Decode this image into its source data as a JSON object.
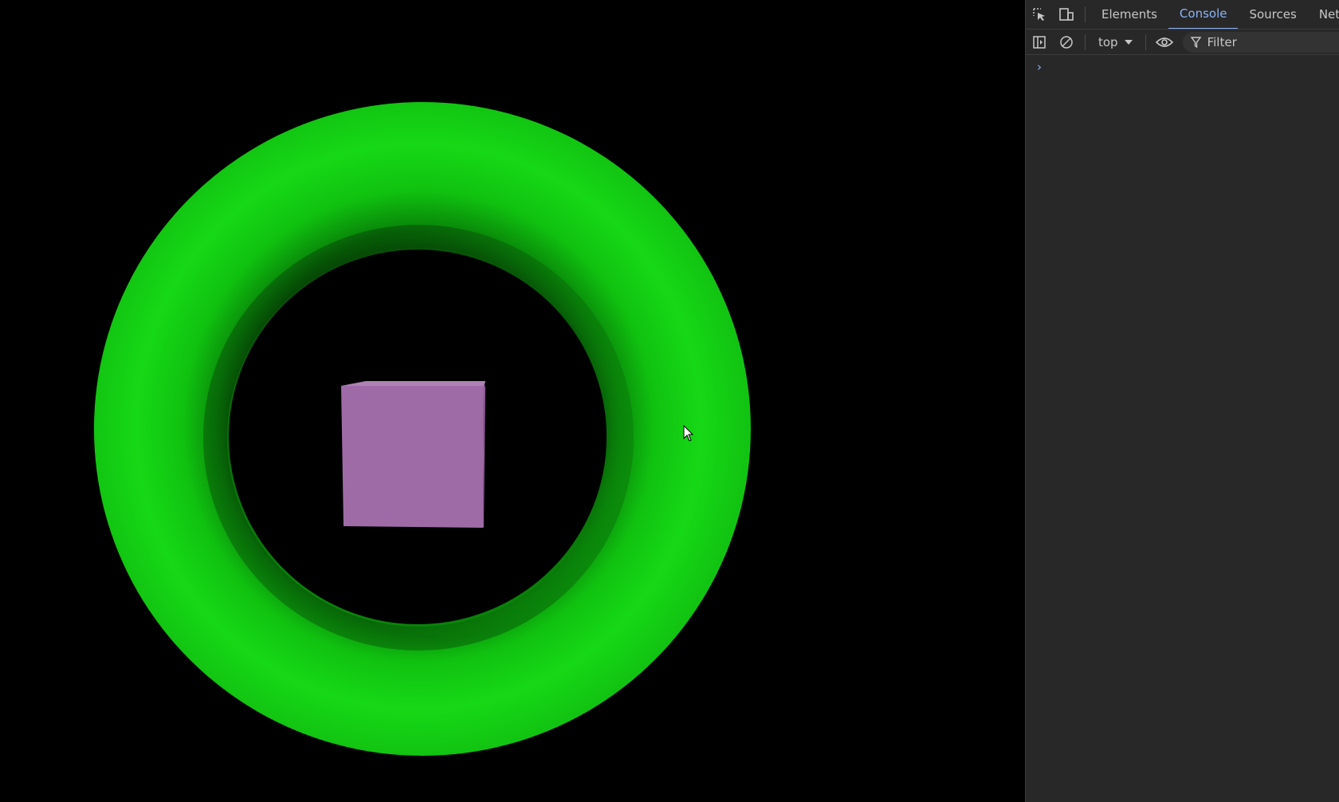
{
  "devtools": {
    "tabs": [
      {
        "label": "Elements",
        "active": false
      },
      {
        "label": "Console",
        "active": true
      },
      {
        "label": "Sources",
        "active": false
      },
      {
        "label": "Netwo",
        "active": false
      }
    ],
    "toolbar": {
      "context_label": "top",
      "filter_placeholder": "Filter"
    },
    "console": {
      "prompt_symbol": "›"
    },
    "icons": {
      "inspect": "inspect-element-icon",
      "device": "device-toolbar-icon",
      "sidebar": "show-sidebar-icon",
      "clear": "clear-console-icon",
      "live_expression": "eye-icon",
      "filter": "filter-icon",
      "dropdown": "chevron-down-icon"
    },
    "colors": {
      "panel_bg": "#282828",
      "active_tab": "#8ab4f8",
      "text": "#c7c7c7"
    }
  },
  "scene": {
    "torus_color": "#14d414",
    "cube_color": "#a06ba8",
    "background": "#000000",
    "objects": [
      "torus",
      "cube"
    ]
  }
}
